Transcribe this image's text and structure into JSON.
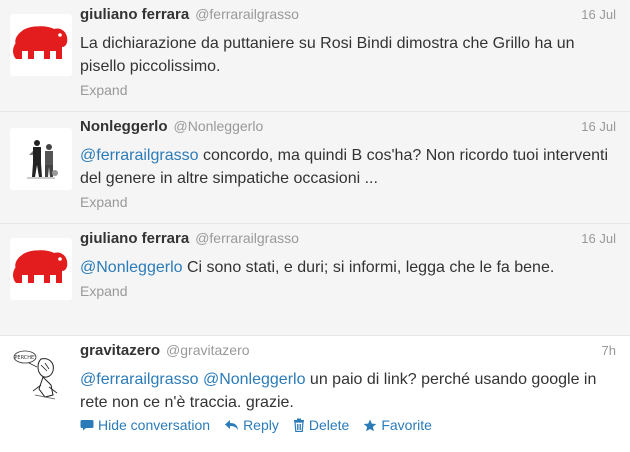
{
  "tweets": [
    {
      "fullname": "giuliano ferrara",
      "username": "@ferrarailgrasso",
      "time": "16 Jul",
      "text_parts": [
        "La dichiarazione da puttaniere su Rosi Bindi dimostra che Grillo ha un pisello piccolissimo."
      ],
      "expand": "Expand",
      "avatar_icon": "red-elephant-icon"
    },
    {
      "fullname": "Nonleggerlo",
      "username": "@Nonleggerlo",
      "time": "16 Jul",
      "mention": "@ferrarailgrasso",
      "text": " concordo, ma quindi B cos'ha? Non ricordo tuoi interventi del genere in altre simpatiche occasioni ...",
      "expand": "Expand",
      "avatar_icon": "figures-photo-icon"
    },
    {
      "fullname": "giuliano ferrara",
      "username": "@ferrarailgrasso",
      "time": "16 Jul",
      "mention": "@Nonleggerlo",
      "text": " Ci sono stati, e duri; si informi, legga che le fa bene.",
      "expand": "Expand",
      "avatar_icon": "red-elephant-icon"
    },
    {
      "fullname": "gravitazero",
      "username": "@gravitazero",
      "time": "7h",
      "mention1": "@ferrarailgrasso",
      "mention2": "@Nonleggerlo",
      "text": " un paio di link? perché usando google in rete non ce n'è traccia. grazie.",
      "avatar_icon": "sketch-drawing-icon",
      "avatar_caption": "PERCHE'",
      "actions": {
        "hide": "Hide conversation",
        "reply": "Reply",
        "delete": "Delete",
        "favorite": "Favorite"
      }
    }
  ],
  "colors": {
    "link": "#2b7bb9",
    "elephant": "#e31d1d",
    "meta": "#999999"
  }
}
